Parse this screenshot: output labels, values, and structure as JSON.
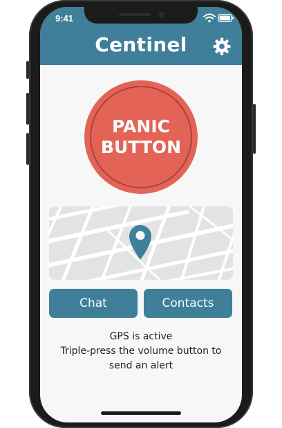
{
  "status_bar": {
    "time": "9:41",
    "icons": [
      "wifi-icon",
      "battery-icon"
    ]
  },
  "app": {
    "title": "Centinel",
    "settings_icon": "gear-icon"
  },
  "panic_button": {
    "line1": "PANIC",
    "line2": "BUTTON",
    "color": "#e46357"
  },
  "map": {
    "marker_icon": "map-pin-icon",
    "marker_color": "#3f7f99"
  },
  "actions": {
    "chat_label": "Chat",
    "contacts_label": "Contacts"
  },
  "info": {
    "line1": "GPS is active",
    "line2": "Triple-press the volume button to",
    "line3": "send an alert"
  },
  "colors": {
    "accent": "#3f7f99",
    "panic": "#e46357",
    "background": "#f7f7f7"
  }
}
